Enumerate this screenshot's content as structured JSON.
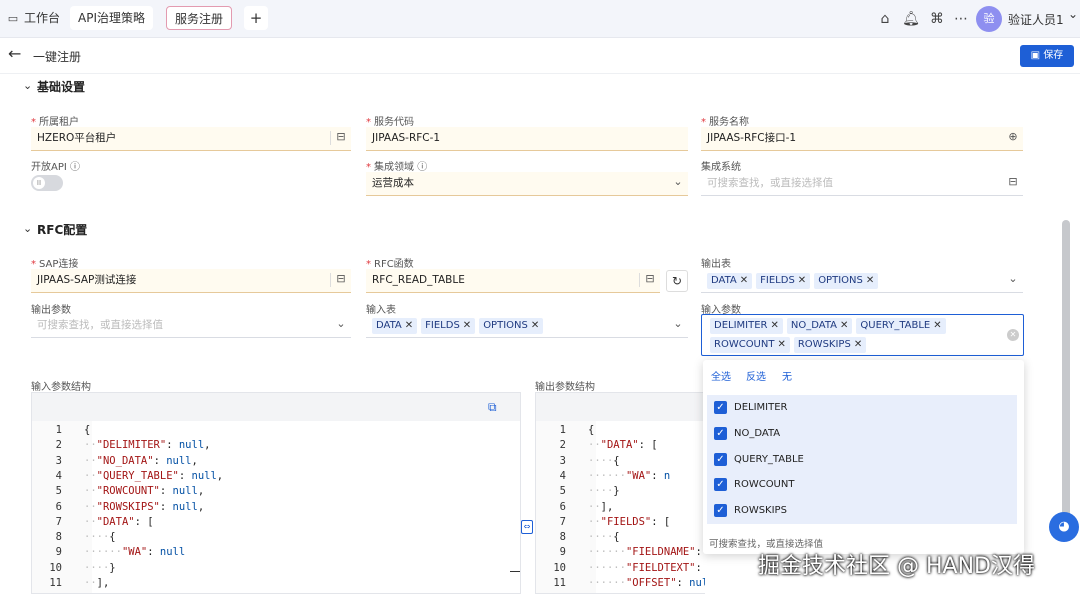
{
  "topbar": {
    "tabs": [
      {
        "label": "工作台"
      },
      {
        "label": "API治理策略"
      },
      {
        "label": "服务注册"
      }
    ],
    "add_tab": "+",
    "user": {
      "avatar_text": "验",
      "name": "验证人员1",
      "caret": "⌄"
    },
    "icons": [
      "home-icon",
      "bell-icon",
      "shirt-icon",
      "more-icon"
    ]
  },
  "header": {
    "back_arrow": "←",
    "title": "一键注册",
    "save_label": "保存"
  },
  "basic": {
    "section_title": "基础设置",
    "tenant": {
      "label": "所属租户",
      "value": "HZERO平台租户"
    },
    "service_code": {
      "label": "服务代码",
      "value": "JIPAAS-RFC-1"
    },
    "service_name": {
      "label": "服务名称",
      "value": "JIPAAS-RFC接口-1"
    },
    "open_api": {
      "label": "开放API",
      "enabled": false
    },
    "domain": {
      "label": "集成领域",
      "value": "运营成本"
    },
    "system": {
      "label": "集成系统",
      "placeholder": "可搜索查找，或直接选择值"
    }
  },
  "rfc": {
    "section_title": "RFC配置",
    "sap": {
      "label": "SAP连接",
      "value": "JIPAAS-SAP测试连接"
    },
    "func": {
      "label": "RFC函数",
      "value": "RFC_READ_TABLE"
    },
    "output_table": {
      "label": "输出表",
      "tags": [
        "DATA",
        "FIELDS",
        "OPTIONS"
      ]
    },
    "output_params": {
      "label": "输出参数",
      "placeholder": "可搜索查找，或直接选择值"
    },
    "input_table": {
      "label": "输入表",
      "tags": [
        "DATA",
        "FIELDS",
        "OPTIONS"
      ]
    },
    "input_params": {
      "label": "输入参数",
      "tags": [
        "DELIMITER",
        "NO_DATA",
        "QUERY_TABLE",
        "ROWCOUNT",
        "ROWSKIPS"
      ]
    }
  },
  "input_struct": {
    "label": "输入参数结构",
    "lines": [
      {
        "n": "1",
        "code": "{"
      },
      {
        "n": "2",
        "code": "  \"DELIMITER\": null,"
      },
      {
        "n": "3",
        "code": "  \"NO_DATA\": null,"
      },
      {
        "n": "4",
        "code": "  \"QUERY_TABLE\": null,"
      },
      {
        "n": "5",
        "code": "  \"ROWCOUNT\": null,"
      },
      {
        "n": "6",
        "code": "  \"ROWSKIPS\": null,"
      },
      {
        "n": "7",
        "code": "  \"DATA\": ["
      },
      {
        "n": "8",
        "code": "    {"
      },
      {
        "n": "9",
        "code": "      \"WA\": null"
      },
      {
        "n": "10",
        "code": "    }"
      },
      {
        "n": "11",
        "code": "  ],"
      }
    ]
  },
  "output_struct": {
    "label": "输出参数结构",
    "lines": [
      {
        "n": "1",
        "code": "{"
      },
      {
        "n": "2",
        "code": "  \"DATA\": ["
      },
      {
        "n": "3",
        "code": "    {"
      },
      {
        "n": "4",
        "code": "      \"WA\": n"
      },
      {
        "n": "5",
        "code": "    }"
      },
      {
        "n": "6",
        "code": "  ],"
      },
      {
        "n": "7",
        "code": "  \"FIELDS\": ["
      },
      {
        "n": "8",
        "code": "    {"
      },
      {
        "n": "9",
        "code": "      \"FIELDNAME\": nul"
      },
      {
        "n": "10",
        "code": "      \"FIELDTEXT\": nul"
      },
      {
        "n": "11",
        "code": "      \"OFFSET\": null,"
      }
    ]
  },
  "dropdown": {
    "actions": [
      "全选",
      "反选",
      "无"
    ],
    "options": [
      "DELIMITER",
      "NO_DATA",
      "QUERY_TABLE",
      "ROWCOUNT",
      "ROWSKIPS"
    ],
    "hint": "可搜索查找，或直接选择值"
  },
  "watermark": "掘金技术社区 @ HAND汉得",
  "colors": {
    "primary": "#1e5fd6",
    "required": "#e0383e",
    "tag_bg": "#e6eefc"
  }
}
